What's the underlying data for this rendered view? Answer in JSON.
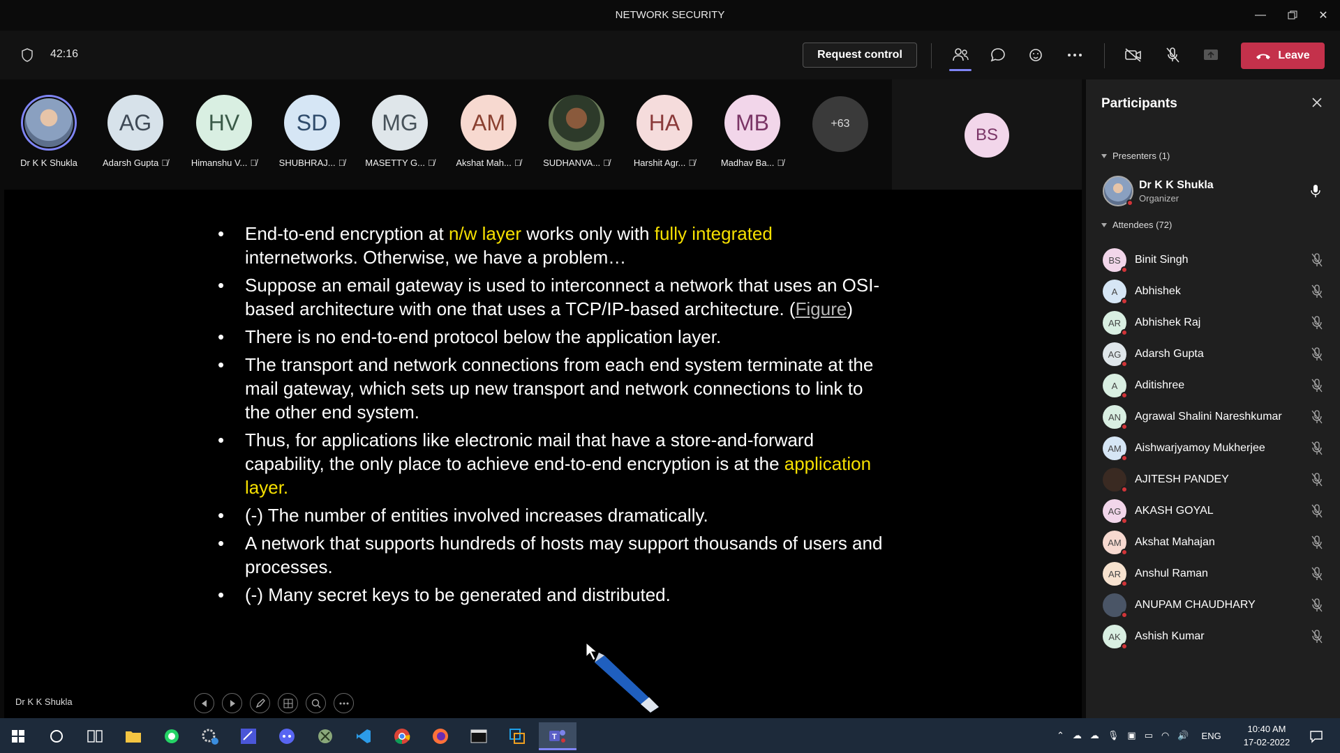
{
  "window": {
    "title": "NETWORK SECURITY"
  },
  "toolbar": {
    "timer": "42:16",
    "request_control": "Request control",
    "leave": "Leave"
  },
  "gallery": {
    "tiles": [
      {
        "initials": "",
        "name": "Dr K K Shukla",
        "color": "#8aa0c0"
      },
      {
        "initials": "AG",
        "name": "Adarsh Gupta",
        "color": "#d7e2ea"
      },
      {
        "initials": "HV",
        "name": "Himanshu V...",
        "color": "#d9efe2"
      },
      {
        "initials": "SD",
        "name": "SHUBHRAJ...",
        "color": "#d6e6f5"
      },
      {
        "initials": "MG",
        "name": "MASETTY G...",
        "color": "#dfe6ea"
      },
      {
        "initials": "AM",
        "name": "Akshat Mah...",
        "color": "#f7d9d0"
      },
      {
        "initials": "",
        "name": "SUDHANVA...",
        "color": "#4a5a3e"
      },
      {
        "initials": "HA",
        "name": "Harshit Agr...",
        "color": "#f5dcdc"
      },
      {
        "initials": "MB",
        "name": "Madhav Ba...",
        "color": "#f2d6ea"
      }
    ],
    "more_count": "+63",
    "bs_initials": "BS"
  },
  "slide": {
    "bullets": [
      [
        {
          "t": "End-to-end encryption at "
        },
        {
          "t": "n/w layer",
          "hl": true
        },
        {
          "t": " works only with "
        },
        {
          "t": "fully integrated",
          "hl": true
        },
        {
          "t": " internetworks. Otherwise, we have a problem…"
        }
      ],
      [
        {
          "t": "Suppose an email gateway is used to interconnect a network that uses an OSI-based architecture with one that uses a TCP/IP-based architecture. ("
        },
        {
          "t": "Figure",
          "link": true
        },
        {
          "t": ")"
        }
      ],
      [
        {
          "t": "There is no end-to-end protocol below the application layer."
        }
      ],
      [
        {
          "t": "The transport and network connections from each end system terminate at the mail gateway, which sets up new transport and network connections to link to the other end system."
        }
      ],
      [
        {
          "t": "Thus, for applications like electronic mail that have a store-and-forward capability, the only place to achieve end-to-end encryption is at the "
        },
        {
          "t": "application layer.",
          "hl": true
        }
      ],
      [
        {
          "t": "(-) The number of entities involved increases dramatically."
        }
      ],
      [
        {
          "t": "A network that supports hundreds of hosts may support thousands of users and processes."
        }
      ],
      [
        {
          "t": "(-) Many secret keys to be generated and distributed."
        }
      ]
    ],
    "presenter_label": "Dr K K Shukla"
  },
  "participants": {
    "title": "Participants",
    "presenters_header": "Presenters (1)",
    "presenter": {
      "name": "Dr K K Shukla",
      "role": "Organizer"
    },
    "attendees_header": "Attendees (72)",
    "attendees": [
      {
        "initials": "BS",
        "name": "Binit Singh",
        "color": "#f2d6ea"
      },
      {
        "initials": "A",
        "name": "Abhishek",
        "color": "#d6e6f5"
      },
      {
        "initials": "AR",
        "name": "Abhishek Raj",
        "color": "#d9efe2"
      },
      {
        "initials": "AG",
        "name": "Adarsh Gupta",
        "color": "#dfe6ea"
      },
      {
        "initials": "A",
        "name": "Aditishree",
        "color": "#d9efe2"
      },
      {
        "initials": "AN",
        "name": "Agrawal Shalini Nareshkumar",
        "color": "#d9efe2"
      },
      {
        "initials": "AM",
        "name": "Aishwarjyamoy Mukherjee",
        "color": "#d6e6f5"
      },
      {
        "initials": "",
        "name": "AJITESH PANDEY",
        "color": "#3a2a22"
      },
      {
        "initials": "AG",
        "name": "AKASH GOYAL",
        "color": "#f2d6ea"
      },
      {
        "initials": "AM",
        "name": "Akshat Mahajan",
        "color": "#f7d9d0"
      },
      {
        "initials": "AR",
        "name": "Anshul Raman",
        "color": "#f7e2cf"
      },
      {
        "initials": "",
        "name": "ANUPAM CHAUDHARY",
        "color": "#4a5566"
      },
      {
        "initials": "AK",
        "name": "Ashish Kumar",
        "color": "#d9efe2"
      }
    ]
  },
  "taskbar": {
    "lang": "ENG",
    "time": "10:40 AM",
    "date": "17-02-2022"
  }
}
